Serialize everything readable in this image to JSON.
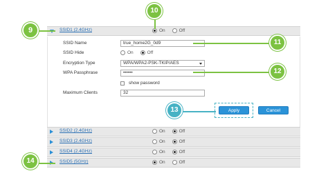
{
  "ssid_rows": [
    {
      "label": "SSID1 (2.4GHz)",
      "on_label": "On",
      "off_label": "Off",
      "selected": "on",
      "expanded": true
    },
    {
      "label": "SSID2 (2.4GHz)",
      "on_label": "On",
      "off_label": "Off",
      "selected": "off",
      "expanded": false
    },
    {
      "label": "SSID3 (2.4GHz)",
      "on_label": "On",
      "off_label": "Off",
      "selected": "off",
      "expanded": false
    },
    {
      "label": "SSID4 (2.4GHz)",
      "on_label": "On",
      "off_label": "Off",
      "selected": "off",
      "expanded": false
    },
    {
      "label": "SSID5 (5GHz)",
      "on_label": "On",
      "off_label": "Off",
      "selected": "on",
      "expanded": false
    }
  ],
  "form": {
    "ssid_name_label": "SSID Name",
    "ssid_name_value": "true_home2G_0d9",
    "ssid_hide_label": "SSID Hide",
    "ssid_hide_on": "On",
    "ssid_hide_off": "Off",
    "encryption_label": "Encryption Type",
    "encryption_value": "WPA/WPA2-PSK-TKIP/AES",
    "passphrase_label": "WPA Passphrase",
    "passphrase_value": "••••••",
    "show_password_label": "show password",
    "max_clients_label": "Maximum Clients",
    "max_clients_value": "32"
  },
  "buttons": {
    "apply": "Apply",
    "cancel": "Cancel"
  },
  "callouts": {
    "c9": "9",
    "c10": "10",
    "c11": "11",
    "c12": "12",
    "c13": "13",
    "c14": "14"
  },
  "colors": {
    "accent_blue": "#2b93d8",
    "callout_green": "#7cc242",
    "callout_teal": "#47b2c4"
  }
}
